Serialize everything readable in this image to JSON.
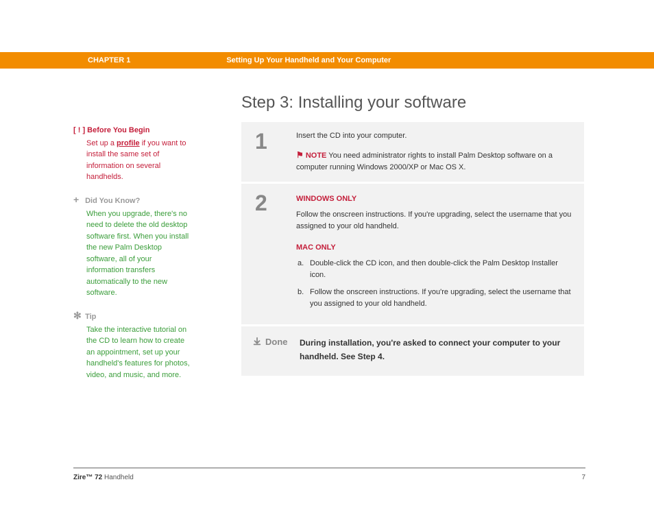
{
  "header": {
    "chapter": "CHAPTER 1",
    "section": "Setting Up Your Handheld and Your Computer"
  },
  "title": "Step 3: Installing your software",
  "sidebar": {
    "before": {
      "icon": "[ ! ]",
      "heading": "Before You Begin",
      "pre": "Set up a ",
      "link": "profile",
      "post": " if you want to install the same set of information on several handhelds."
    },
    "dyk": {
      "heading": "Did You Know?",
      "text": "When you upgrade, there's no need to delete the old desktop software first. When you install the new Palm Desktop software, all of your information transfers automatically to the new software."
    },
    "tip": {
      "heading": "Tip",
      "text": "Take the interactive tutorial on the CD to learn how to create an appointment, set up your handheld's features for photos, video, and music, and more."
    }
  },
  "steps": {
    "s1": {
      "num": "1",
      "text": "Insert the CD into your computer.",
      "note_label": "NOTE",
      "note_text": "You need administrator rights to install Palm Desktop software on a computer running Windows 2000/XP or Mac OS X."
    },
    "s2": {
      "num": "2",
      "win_heading": "WINDOWS ONLY",
      "win_text": "Follow the onscreen instructions. If you're upgrading, select the username that you assigned to your old handheld.",
      "mac_heading": "MAC ONLY",
      "mac_a": "Double-click the CD icon, and then double-click the Palm Desktop Installer icon.",
      "mac_b": "Follow the onscreen instructions. If you're upgrading, select the username that you assigned to your old handheld."
    },
    "done": {
      "label": "Done",
      "text": "During installation, you're asked to connect your computer to your handheld. See Step 4."
    }
  },
  "footer": {
    "product_bold": "Zire™ 72",
    "product_rest": " Handheld",
    "page": "7"
  }
}
